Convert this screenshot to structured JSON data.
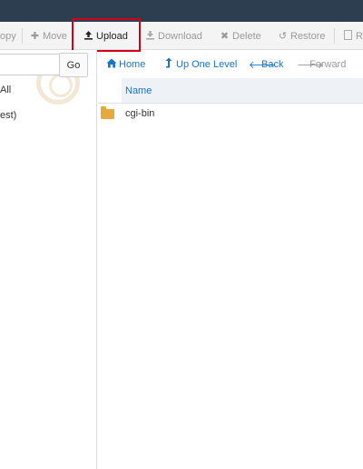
{
  "toolbar": {
    "copy_label": "opy",
    "move_label": "Move",
    "upload_label": "Upload",
    "download_label": "Download",
    "delete_label": "Delete",
    "restore_label": "Restore",
    "rename_label": "Re"
  },
  "sidebar": {
    "go_label": "Go",
    "collapse_all_label": "All",
    "tree_item_label": "est)"
  },
  "nav": {
    "home_label": "Home",
    "up_label": "Up One Level",
    "back_label": "Back",
    "forward_label": "Forward"
  },
  "table": {
    "columns": [
      "Name"
    ],
    "rows": [
      {
        "name": "cgi-bin",
        "type": "folder"
      }
    ]
  },
  "colors": {
    "accent": "#1a73c9",
    "highlight": "#d0021b",
    "folder": "#e8a93a",
    "topbar": "#2c3e50"
  },
  "icons": {
    "copy": "copy-icon",
    "move": "plus-icon",
    "upload": "upload-icon",
    "download": "download-icon",
    "delete": "x-icon",
    "restore": "undo-icon",
    "rename": "file-icon",
    "home": "home-icon",
    "up": "level-up-icon",
    "back": "arrow-left-icon",
    "forward": "arrow-right-icon",
    "folder": "folder-icon"
  }
}
